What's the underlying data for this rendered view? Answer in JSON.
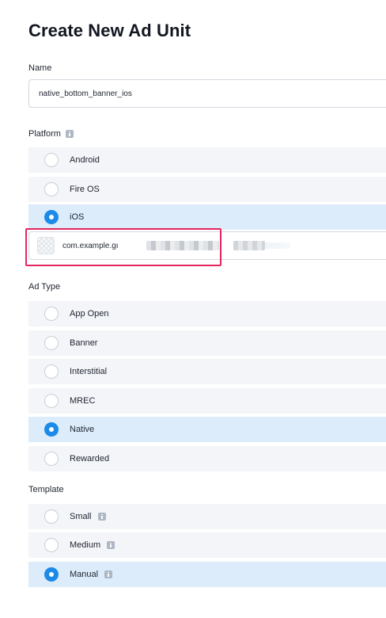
{
  "header": {
    "title": "Create New Ad Unit"
  },
  "name_field": {
    "label": "Name",
    "value": "native_bottom_banner_ios"
  },
  "platform": {
    "label": "Platform",
    "info_icon": "info-icon",
    "options": [
      {
        "label": "Android",
        "selected": false
      },
      {
        "label": "Fire OS",
        "selected": false
      },
      {
        "label": "iOS",
        "selected": true
      }
    ],
    "bundle": {
      "icon": "app-icon",
      "value": "com.example.gı"
    }
  },
  "ad_type": {
    "label": "Ad Type",
    "options": [
      {
        "label": "App Open",
        "selected": false
      },
      {
        "label": "Banner",
        "selected": false
      },
      {
        "label": "Interstitial",
        "selected": false
      },
      {
        "label": "MREC",
        "selected": false
      },
      {
        "label": "Native",
        "selected": true
      },
      {
        "label": "Rewarded",
        "selected": false
      }
    ]
  },
  "template": {
    "label": "Template",
    "options": [
      {
        "label": "Small",
        "selected": false,
        "info_icon": "info-icon"
      },
      {
        "label": "Medium",
        "selected": false,
        "info_icon": "info-icon"
      },
      {
        "label": "Manual",
        "selected": true,
        "info_icon": "info-icon"
      }
    ]
  },
  "colors": {
    "accent": "#1c8ae8",
    "selected_row": "#dcecfa",
    "row": "#f3f5f8",
    "highlight": "#e3265f"
  }
}
